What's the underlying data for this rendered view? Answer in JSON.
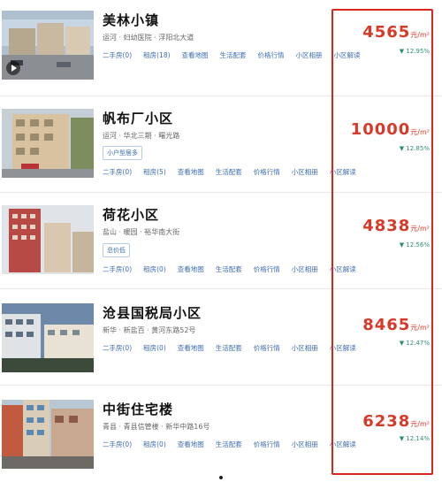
{
  "listings": [
    {
      "name": "美林小镇",
      "address": "运河 · 妇幼医院 · 浮阳北大道",
      "tag": "",
      "links": [
        "二手房(0)",
        "租房(18)",
        "查看地图",
        "生活配套",
        "价格行情",
        "小区相册",
        "小区解读"
      ],
      "price": "4565",
      "unit": "元/m²",
      "change": "▼ 12.95%",
      "has_video": true
    },
    {
      "name": "帆布厂小区",
      "address": "运河 · 华北三期 · 曙光路",
      "tag": "小户型居多",
      "links": [
        "二手房(0)",
        "租房(5)",
        "查看地图",
        "生活配套",
        "价格行情",
        "小区相册",
        "小区解读"
      ],
      "price": "10000",
      "unit": "元/m²",
      "change": "▼ 12.85%",
      "has_video": false
    },
    {
      "name": "荷花小区",
      "address": "盐山 · 暖园 · 裕华南大街",
      "tag": "总价低",
      "links": [
        "二手房(0)",
        "租房(0)",
        "查看地图",
        "生活配套",
        "价格行情",
        "小区相册",
        "小区解读"
      ],
      "price": "4838",
      "unit": "元/m²",
      "change": "▼ 12.56%",
      "has_video": false
    },
    {
      "name": "沧县国税局小区",
      "address": "新华 · 新盐百 · 黄河东路52号",
      "tag": "",
      "links": [
        "二手房(0)",
        "租房(0)",
        "查看地图",
        "生活配套",
        "价格行情",
        "小区相册",
        "小区解读"
      ],
      "price": "8465",
      "unit": "元/m²",
      "change": "▼ 12.47%",
      "has_video": false
    },
    {
      "name": "中街住宅楼",
      "address": "青县 · 青县信管楼 · 新华中路16号",
      "tag": "",
      "links": [
        "二手房(0)",
        "租房(0)",
        "查看地图",
        "生活配套",
        "价格行情",
        "小区相册",
        "小区解读"
      ],
      "price": "6238",
      "unit": "元/m²",
      "change": "▼ 12.14%",
      "has_video": false
    }
  ],
  "colors": {
    "price": "#d83a2a",
    "link": "#3c6cb4",
    "change_down": "#2e8f74",
    "highlight_box": "#d8261c"
  },
  "icons": {
    "video": "play-icon"
  }
}
